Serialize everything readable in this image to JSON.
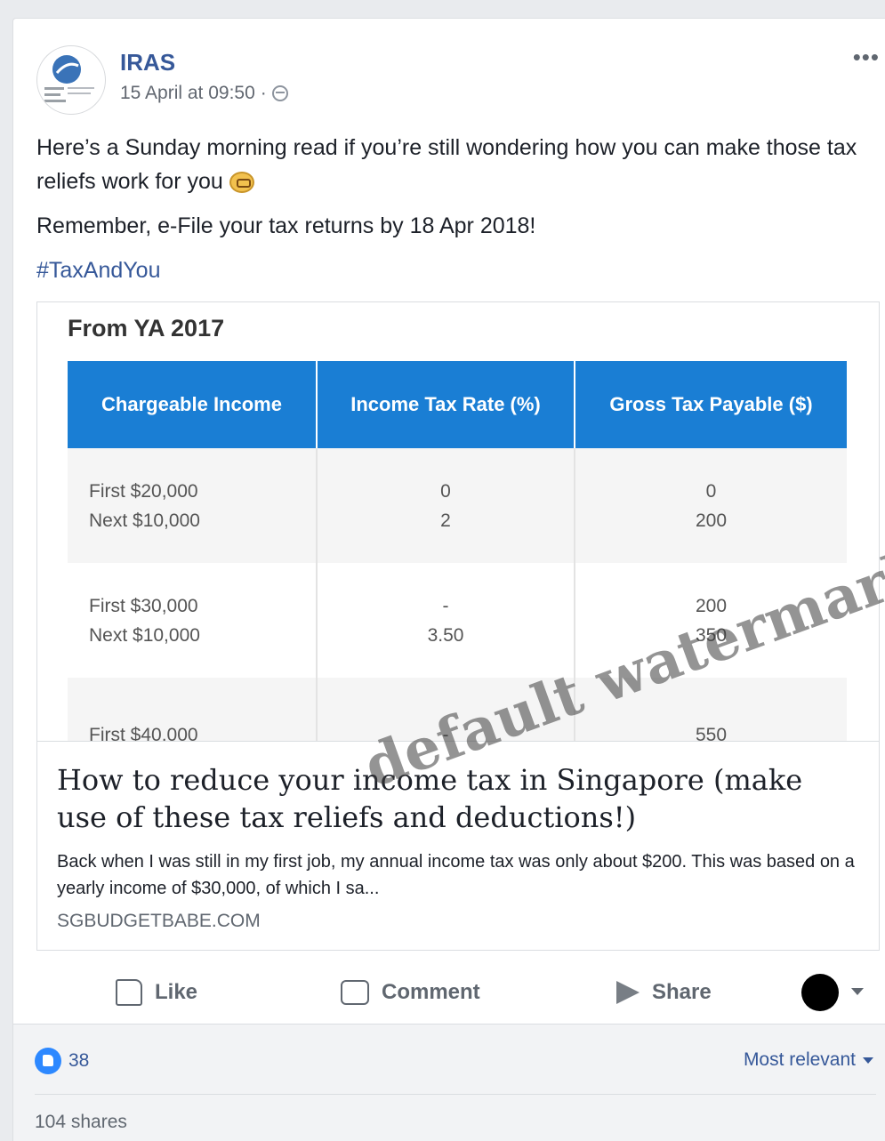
{
  "post": {
    "page_name": "IRAS",
    "timestamp": "15 April at 09:50",
    "separator": "·",
    "more_label": "•••",
    "text_line1": "Here’s a Sunday morning read if you’re still wondering how you can make those tax reliefs work for you",
    "text_line2": "Remember, e-File your tax returns by 18 Apr 2018!",
    "hashtag": "#TaxAndYou",
    "avatar_text": "INLAND REVENUE AUTHORITY OF SINGAPORE"
  },
  "preview": {
    "table_title": "From YA 2017",
    "columns": [
      "Chargeable Income",
      "Income Tax Rate (%)",
      "Gross Tax Payable ($)"
    ],
    "rows": [
      {
        "income": [
          "First $20,000",
          "Next $10,000"
        ],
        "rate": [
          "0",
          "2"
        ],
        "payable": [
          "0",
          "200"
        ]
      },
      {
        "income": [
          "First $30,000",
          "Next $10,000"
        ],
        "rate": [
          "-",
          "3.50"
        ],
        "payable": [
          "200",
          "350"
        ]
      },
      {
        "income": [
          "First $40,000"
        ],
        "rate": [
          "-"
        ],
        "payable": [
          "550"
        ]
      }
    ],
    "link_title": "How to reduce your income tax in Singapore (make use of these tax reliefs and deductions!)",
    "link_description": "Back when I was still in my first job, my annual income tax was only about $200. This was based on a yearly income of $30,000, of which I sa...",
    "link_domain": "SGBUDGETBABE.COM"
  },
  "actions": {
    "like": "Like",
    "comment": "Comment",
    "share": "Share"
  },
  "footer": {
    "like_count": "38",
    "sort_label": "Most relevant",
    "shares": "104 shares"
  },
  "watermark": "default watermark",
  "colors": {
    "link_blue": "#365899",
    "table_header": "#1a7ed4",
    "like_blue": "#2d88ff"
  }
}
